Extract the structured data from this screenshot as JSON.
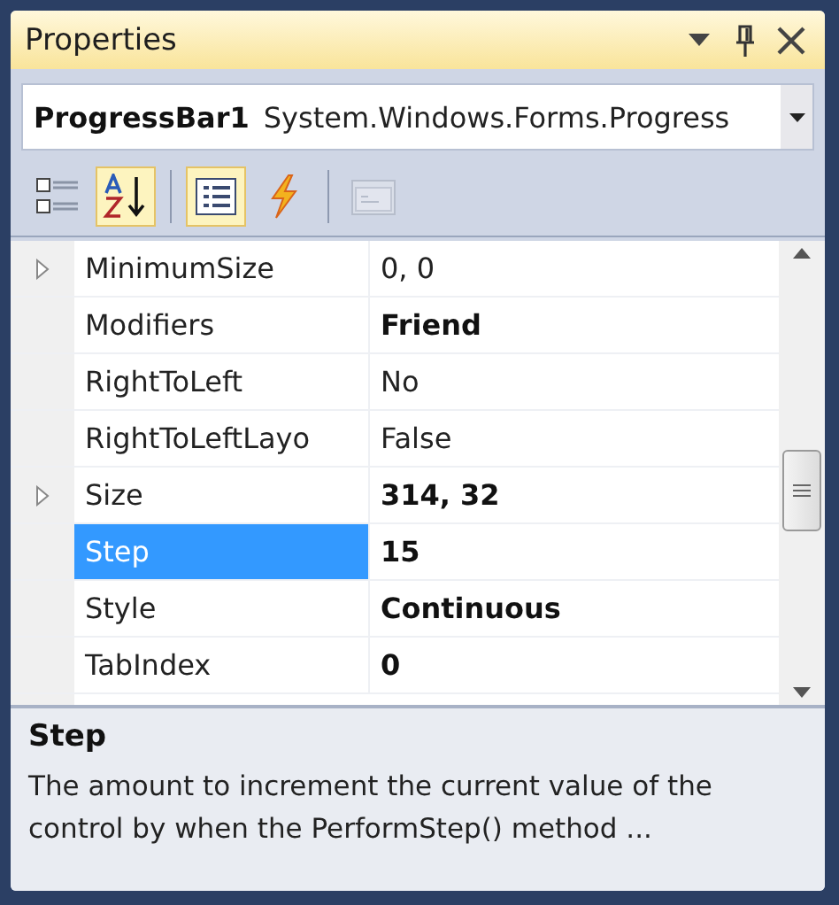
{
  "window": {
    "title": "Properties"
  },
  "object_selector": {
    "name": "ProgressBar1",
    "type": "System.Windows.Forms.Progress"
  },
  "toolbar": [
    {
      "kind": "categorized",
      "selected": false,
      "disabled": false
    },
    {
      "kind": "alphabetical",
      "selected": true,
      "disabled": false
    },
    {
      "kind": "properties",
      "selected": true,
      "disabled": false
    },
    {
      "kind": "events",
      "selected": false,
      "disabled": false
    },
    {
      "kind": "property-pages",
      "selected": false,
      "disabled": true
    }
  ],
  "properties": [
    {
      "name": "MinimumSize",
      "value": "0, 0",
      "expandable": true,
      "modified": false,
      "selected": false
    },
    {
      "name": "Modifiers",
      "value": "Friend",
      "expandable": false,
      "modified": true,
      "selected": false
    },
    {
      "name": "RightToLeft",
      "value": "No",
      "expandable": false,
      "modified": false,
      "selected": false
    },
    {
      "name": "RightToLeftLayo",
      "value": "False",
      "expandable": false,
      "modified": false,
      "selected": false
    },
    {
      "name": "Size",
      "value": "314, 32",
      "expandable": true,
      "modified": true,
      "selected": false
    },
    {
      "name": "Step",
      "value": "15",
      "expandable": false,
      "modified": true,
      "selected": true
    },
    {
      "name": "Style",
      "value": "Continuous",
      "expandable": false,
      "modified": true,
      "selected": false
    },
    {
      "name": "TabIndex",
      "value": "0",
      "expandable": false,
      "modified": true,
      "selected": false
    }
  ],
  "description": {
    "title": "Step",
    "text": "The amount to increment the current value of the control by when the PerformStep() method ..."
  }
}
